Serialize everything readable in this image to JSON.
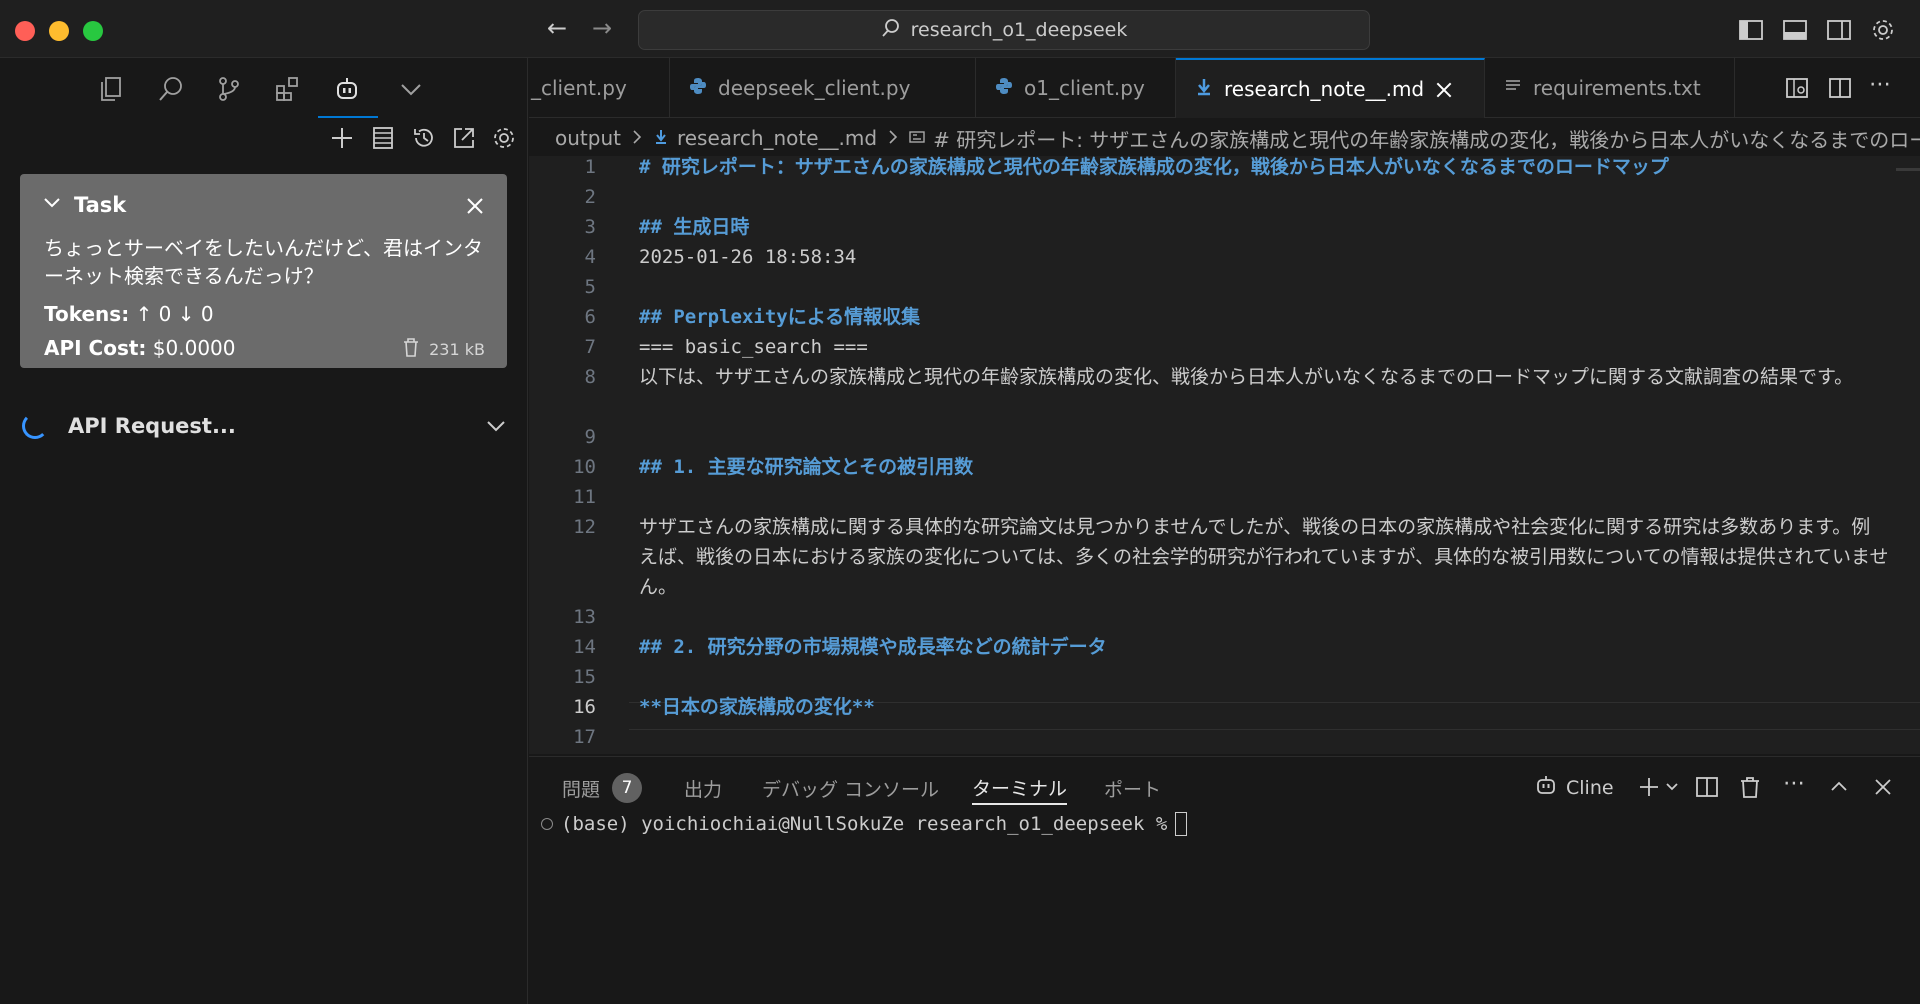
{
  "titlebar": {
    "command_center_text": "research_o1_deepseek"
  },
  "sidebar": {
    "task": {
      "header": "Task",
      "text": "ちょっとサーベイをしたいんだけど、君はインターネット検索できるんだっけ？",
      "tokens_label": "Tokens:",
      "tokens_value": "↑ 0 ↓ 0",
      "cost_label": "API Cost:",
      "cost_value": "$0.0000",
      "size": "231 kB"
    },
    "api_request_label": "API Request..."
  },
  "tabs": [
    {
      "label": "_client.py"
    },
    {
      "label": "deepseek_client.py"
    },
    {
      "label": "o1_client.py"
    },
    {
      "label": "research_note__.md"
    },
    {
      "label": "requirements.txt"
    }
  ],
  "breadcrumb": {
    "folder": "output",
    "file": "research_note__.md",
    "symbol": "# 研究レポート: サザエさんの家族構成と現代の年齢家族構成の変化，戦後から日本人がいなくなるまでのロードマップ"
  },
  "editor": {
    "lines": [
      {
        "n": "1",
        "text": "# 研究レポート：サザエさんの家族構成と現代の年齢家族構成の変化，戦後から日本人がいなくなるまでのロードマップ"
      },
      {
        "n": "2",
        "text": ""
      },
      {
        "n": "3",
        "text": "## 生成日時"
      },
      {
        "n": "4",
        "text": "2025-01-26 18:58:34"
      },
      {
        "n": "5",
        "text": ""
      },
      {
        "n": "6",
        "text": "## Perplexityによる情報収集"
      },
      {
        "n": "7",
        "text": "=== basic_search ==="
      },
      {
        "n": "8",
        "text": "以下は、サザエさんの家族構成と現代の年齢家族構成の変化、戦後から日本人がいなくなるまでのロードマップに関する文献調査の結果です。"
      },
      {
        "n": "9",
        "text": ""
      },
      {
        "n": "10",
        "text": "## 1. 主要な研究論文とその被引用数"
      },
      {
        "n": "11",
        "text": ""
      },
      {
        "n": "12",
        "text": "サザエさんの家族構成に関する具体的な研究論文は見つかりませんでしたが、戦後の日本の家族構成や社会変化に関する研究は多数あります。例えば、戦後の日本における家族の変化については、多くの社会学的研究が行われていますが、具体的な被引用数についての情報は提供されていません。"
      },
      {
        "n": "13",
        "text": ""
      },
      {
        "n": "14",
        "text": "## 2. 研究分野の市場規模や成長率などの統計データ"
      },
      {
        "n": "15",
        "text": ""
      },
      {
        "n": "16",
        "text": "**日本の家族構成の変化**"
      },
      {
        "n": "17",
        "text": ""
      }
    ]
  },
  "panel": {
    "tabs": {
      "problems": "問題",
      "problems_count": "7",
      "output": "出力",
      "debug_console": "デバッグ コンソール",
      "terminal": "ターミナル",
      "ports": "ポート"
    },
    "cline_label": "Cline",
    "terminal_prompt": "(base) yoichiochiai@NullSokuZe research_o1_deepseek %"
  },
  "colors": {
    "accent": "#0078d4",
    "heading": "#569cd6",
    "task_card": "#6b6b6b"
  }
}
